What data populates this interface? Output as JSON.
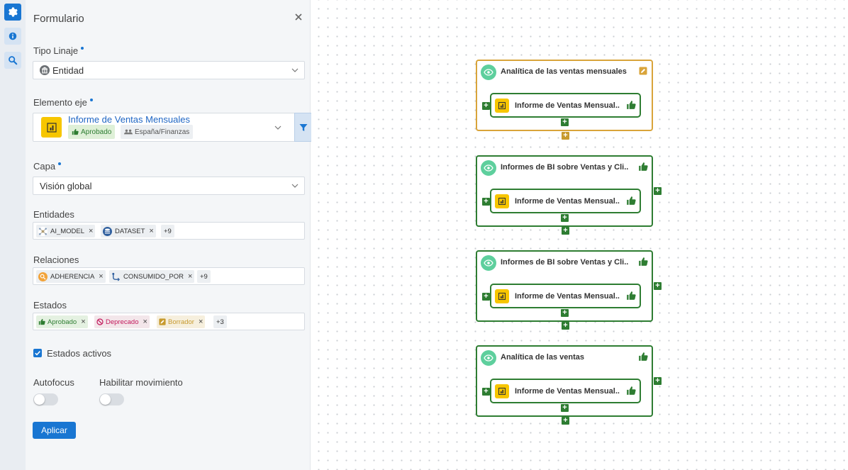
{
  "rail": {
    "icons": [
      "gear-icon",
      "info-icon",
      "search-icon"
    ]
  },
  "panel": {
    "title": "Formulario",
    "tipo_linaje": {
      "label": "Tipo Linaje",
      "value": "Entidad"
    },
    "elemento_eje": {
      "label": "Elemento eje",
      "title": "Informe de Ventas Mensuales",
      "status_badge": "Aprobado",
      "domain_badge": "España/Finanzas"
    },
    "capa": {
      "label": "Capa",
      "value": "Visión global"
    },
    "entidades": {
      "label": "Entidades",
      "tags": [
        "AI_MODEL",
        "DATASET"
      ],
      "more": "+9"
    },
    "relaciones": {
      "label": "Relaciones",
      "tags": [
        "ADHERENCIA",
        "CONSUMIDO_POR"
      ],
      "more": "+9"
    },
    "estados": {
      "label": "Estados",
      "tags": [
        "Aprobado",
        "Deprecado",
        "Borrador"
      ],
      "more": "+3"
    },
    "estados_activos": {
      "label": "Estados activos",
      "checked": true
    },
    "autofocus": {
      "label": "Autofocus",
      "on": false
    },
    "movimiento": {
      "label": "Habilitar movimiento",
      "on": false
    },
    "apply_label": "Aplicar"
  },
  "colors": {
    "accent": "#1976d2",
    "approved": "#2e7d32",
    "selected": "#d9a43a",
    "powerbi": "#f7c600"
  },
  "nodes": [
    {
      "title": "Analítica de las ventas mensuales",
      "status": "pencil-icon",
      "report": "Informe de Ventas Mensual..",
      "selected": true
    },
    {
      "title": "Informes de BI sobre Ventas y Cli..",
      "status": "thumbs-up-icon",
      "report": "Informe de Ventas Mensual..",
      "selected": false
    },
    {
      "title": "Informes de BI sobre Ventas y Cli..",
      "status": "thumbs-up-icon",
      "report": "Informe de Ventas Mensual..",
      "selected": false
    },
    {
      "title": "Analítica de las ventas",
      "status": "thumbs-up-icon",
      "report": "Informe de Ventas Mensual..",
      "selected": false
    }
  ]
}
